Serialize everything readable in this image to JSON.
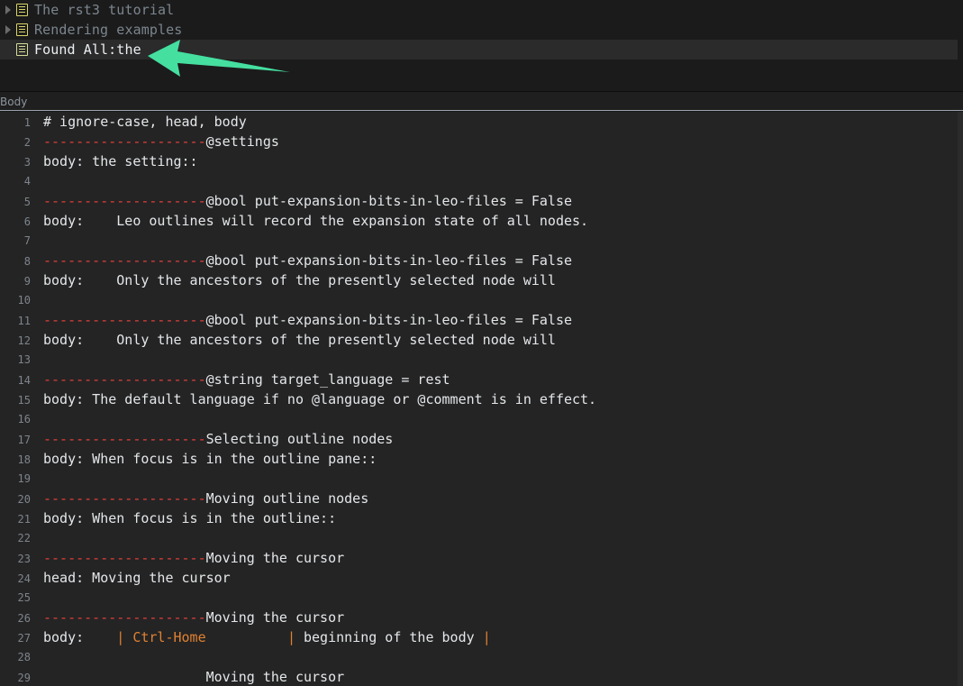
{
  "outline": {
    "pane_name": "outline-pane",
    "items": [
      {
        "label": "The rst3 tutorial",
        "icon": "node-icon",
        "expander": "collapsed-triangle-icon",
        "has_expander": true,
        "selected": false
      },
      {
        "label": "Rendering examples",
        "icon": "node-icon",
        "expander": "collapsed-triangle-icon",
        "has_expander": true,
        "selected": false
      },
      {
        "label": "Found All:the",
        "icon": "node-icon",
        "expander": "none",
        "has_expander": false,
        "selected": true
      }
    ]
  },
  "annotation": {
    "type": "arrow-annotation",
    "direction": "left",
    "color": "#45dfa0"
  },
  "body_pane": {
    "header_label": "Body"
  },
  "colors": {
    "editor_background": "#242424",
    "outline_background": "#1b1b1b",
    "selected_row": "#2b2b2b",
    "dash_red": "#e4413d",
    "keyword_orange": "#e08132",
    "text_white": "#e4e7ea",
    "lineno_gray": "#7d848c",
    "icon_yellow": "#d8d46a",
    "arrow_green": "#45dfa0"
  },
  "editor": {
    "first_visible_line": 1,
    "lines": [
      {
        "n": 1,
        "tokens": [
          {
            "t": "# ignore-case, head, body",
            "c": "plain"
          }
        ]
      },
      {
        "n": 2,
        "tokens": [
          {
            "t": "--------------------",
            "c": "dash"
          },
          {
            "t": "@settings",
            "c": "plain"
          }
        ]
      },
      {
        "n": 3,
        "tokens": [
          {
            "t": "body: the setting::",
            "c": "plain"
          }
        ]
      },
      {
        "n": 4,
        "tokens": [
          {
            "t": "",
            "c": "plain"
          }
        ]
      },
      {
        "n": 5,
        "tokens": [
          {
            "t": "--------------------",
            "c": "dash"
          },
          {
            "t": "@bool put-expansion-bits-in-leo-files = False",
            "c": "plain"
          }
        ]
      },
      {
        "n": 6,
        "tokens": [
          {
            "t": "body:    Leo outlines will record the expansion state of all nodes.",
            "c": "plain"
          }
        ]
      },
      {
        "n": 7,
        "tokens": [
          {
            "t": "",
            "c": "plain"
          }
        ]
      },
      {
        "n": 8,
        "tokens": [
          {
            "t": "--------------------",
            "c": "dash"
          },
          {
            "t": "@bool put-expansion-bits-in-leo-files = False",
            "c": "plain"
          }
        ]
      },
      {
        "n": 9,
        "tokens": [
          {
            "t": "body:    Only the ancestors of the presently selected node will",
            "c": "plain"
          }
        ]
      },
      {
        "n": 10,
        "tokens": [
          {
            "t": "",
            "c": "plain"
          }
        ]
      },
      {
        "n": 11,
        "tokens": [
          {
            "t": "--------------------",
            "c": "dash"
          },
          {
            "t": "@bool put-expansion-bits-in-leo-files = False",
            "c": "plain"
          }
        ]
      },
      {
        "n": 12,
        "tokens": [
          {
            "t": "body:    Only the ancestors of the presently selected node will",
            "c": "plain"
          }
        ]
      },
      {
        "n": 13,
        "tokens": [
          {
            "t": "",
            "c": "plain"
          }
        ]
      },
      {
        "n": 14,
        "tokens": [
          {
            "t": "--------------------",
            "c": "dash"
          },
          {
            "t": "@string target_language = rest",
            "c": "plain"
          }
        ]
      },
      {
        "n": 15,
        "tokens": [
          {
            "t": "body: The default language if no @language or @comment is in effect.",
            "c": "plain"
          }
        ]
      },
      {
        "n": 16,
        "tokens": [
          {
            "t": "",
            "c": "plain"
          }
        ]
      },
      {
        "n": 17,
        "tokens": [
          {
            "t": "--------------------",
            "c": "dash"
          },
          {
            "t": "Selecting outline nodes",
            "c": "plain"
          }
        ]
      },
      {
        "n": 18,
        "tokens": [
          {
            "t": "body: When focus is in the outline pane::",
            "c": "plain"
          }
        ]
      },
      {
        "n": 19,
        "tokens": [
          {
            "t": "",
            "c": "plain"
          }
        ]
      },
      {
        "n": 20,
        "tokens": [
          {
            "t": "--------------------",
            "c": "dash"
          },
          {
            "t": "Moving outline nodes",
            "c": "plain"
          }
        ]
      },
      {
        "n": 21,
        "tokens": [
          {
            "t": "body: When focus is in the outline::",
            "c": "plain"
          }
        ]
      },
      {
        "n": 22,
        "tokens": [
          {
            "t": "",
            "c": "plain"
          }
        ]
      },
      {
        "n": 23,
        "tokens": [
          {
            "t": "--------------------",
            "c": "dash"
          },
          {
            "t": "Moving the cursor",
            "c": "plain"
          }
        ]
      },
      {
        "n": 24,
        "tokens": [
          {
            "t": "head: Moving the cursor",
            "c": "plain"
          }
        ]
      },
      {
        "n": 25,
        "tokens": [
          {
            "t": "",
            "c": "plain"
          }
        ]
      },
      {
        "n": 26,
        "tokens": [
          {
            "t": "--------------------",
            "c": "dash"
          },
          {
            "t": "Moving the cursor",
            "c": "plain"
          }
        ]
      },
      {
        "n": 27,
        "tokens": [
          {
            "t": "body:    ",
            "c": "plain"
          },
          {
            "t": "|",
            "c": "bar"
          },
          {
            "t": " ",
            "c": "plain"
          },
          {
            "t": "Ctrl-Home",
            "c": "key"
          },
          {
            "t": "          ",
            "c": "plain"
          },
          {
            "t": "|",
            "c": "bar"
          },
          {
            "t": " beginning of the body ",
            "c": "plain"
          },
          {
            "t": "|",
            "c": "bar"
          }
        ]
      },
      {
        "n": 28,
        "tokens": [
          {
            "t": "",
            "c": "plain"
          }
        ]
      },
      {
        "n": 29,
        "tokens": [
          {
            "t": "                    ",
            "c": "dash"
          },
          {
            "t": "Moving the cursor",
            "c": "plain"
          }
        ]
      }
    ]
  }
}
